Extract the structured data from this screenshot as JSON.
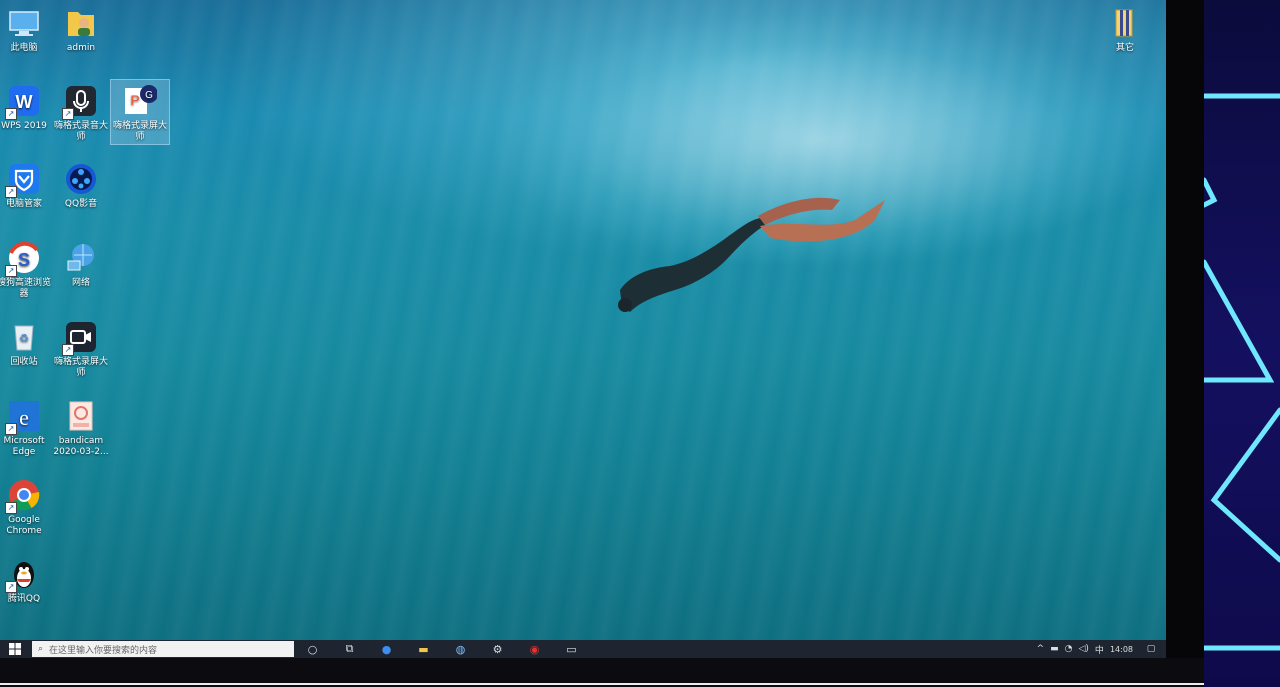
{
  "desktop_icons": [
    {
      "label": "此电脑",
      "icon": "computer-icon"
    },
    {
      "label": "admin",
      "icon": "user-folder-icon"
    },
    {
      "label": "WPS 2019",
      "icon": "wps-icon"
    },
    {
      "label": "嗨格式录音大师",
      "icon": "recorder-icon"
    },
    {
      "label": "嗨格式录屏大师",
      "icon": "screen-recorder-icon"
    },
    {
      "label": "电脑管家",
      "icon": "pc-manager-icon"
    },
    {
      "label": "QQ影音",
      "icon": "qq-player-icon"
    },
    {
      "label": "搜狗高速浏览器",
      "icon": "sogou-browser-icon"
    },
    {
      "label": "网络",
      "icon": "network-icon"
    },
    {
      "label": "回收站",
      "icon": "recycle-bin-icon"
    },
    {
      "label": "嗨格式录屏大师",
      "icon": "camera-recorder-icon"
    },
    {
      "label": "Microsoft Edge",
      "icon": "edge-icon"
    },
    {
      "label": "bandicam 2020-03-2...",
      "icon": "image-file-icon"
    },
    {
      "label": "Google Chrome",
      "icon": "chrome-icon"
    },
    {
      "label": "腾讯QQ",
      "icon": "qq-penguin-icon"
    },
    {
      "label": "其它",
      "icon": "archive-icon"
    }
  ],
  "taskbar": {
    "search_placeholder": "在这里输入你要搜索的内容",
    "tray_ime": "中",
    "clock_time": "14:08"
  }
}
